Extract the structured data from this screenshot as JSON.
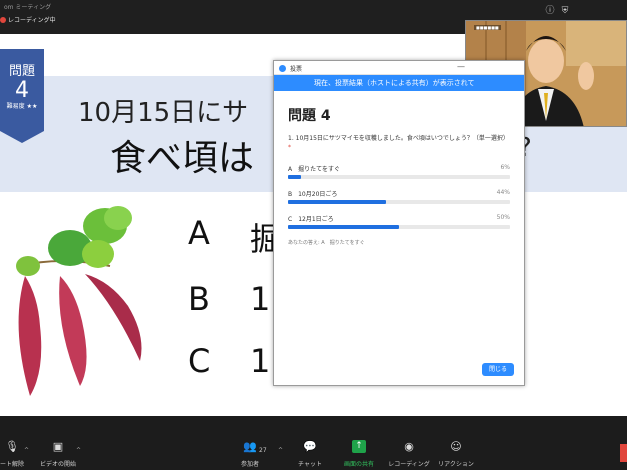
{
  "window": {
    "title": "om ミーティング",
    "recording_label": "レコーディング中"
  },
  "slide": {
    "badge_label": "問題",
    "badge_number": "4",
    "badge_difficulty": "難易度 ★★",
    "question_line1": "10月15日にサ",
    "question_line2": "食べ頃は",
    "question_end": "?",
    "options": [
      {
        "letter": "A",
        "text": "掘"
      },
      {
        "letter": "B",
        "text": "1"
      },
      {
        "letter": "C",
        "text": "1"
      }
    ]
  },
  "webcam": {
    "name_label": "■■■■■■"
  },
  "poll": {
    "window_title": "投票",
    "minimize": "—",
    "notice": "現在、投票結果（ホストによる共有）が表示されて",
    "title": "問題 4",
    "question": "1. 10月15日にサツマイモを収穫しました。食べ頃はいつでしょう？（単一選択）",
    "required_mark": "*",
    "options": [
      {
        "label": "A　掘りたてをすぐ",
        "percent_label": "6%",
        "percent": 6
      },
      {
        "label": "B　10月20日ごろ",
        "percent_label": "44%",
        "percent": 44
      },
      {
        "label": "C　12月1日ごろ",
        "percent_label": "50%",
        "percent": 50
      }
    ],
    "your_answer": "あなたの答え: A　掘りたてをすぐ",
    "close_label": "閉じる"
  },
  "toolbar": {
    "unmute_label": "ート解除",
    "video_label": "ビデオの開始",
    "participants_label": "参加者",
    "participants_count": "27",
    "chat_label": "チャット",
    "share_label": "画面の共有",
    "record_label": "レコーディング",
    "reactions_label": "リアクション"
  },
  "colors": {
    "badge_blue": "#3a5aa0",
    "zoom_blue": "#2d8cff",
    "share_green": "#1fa34a",
    "recording_red": "#e0463c"
  }
}
